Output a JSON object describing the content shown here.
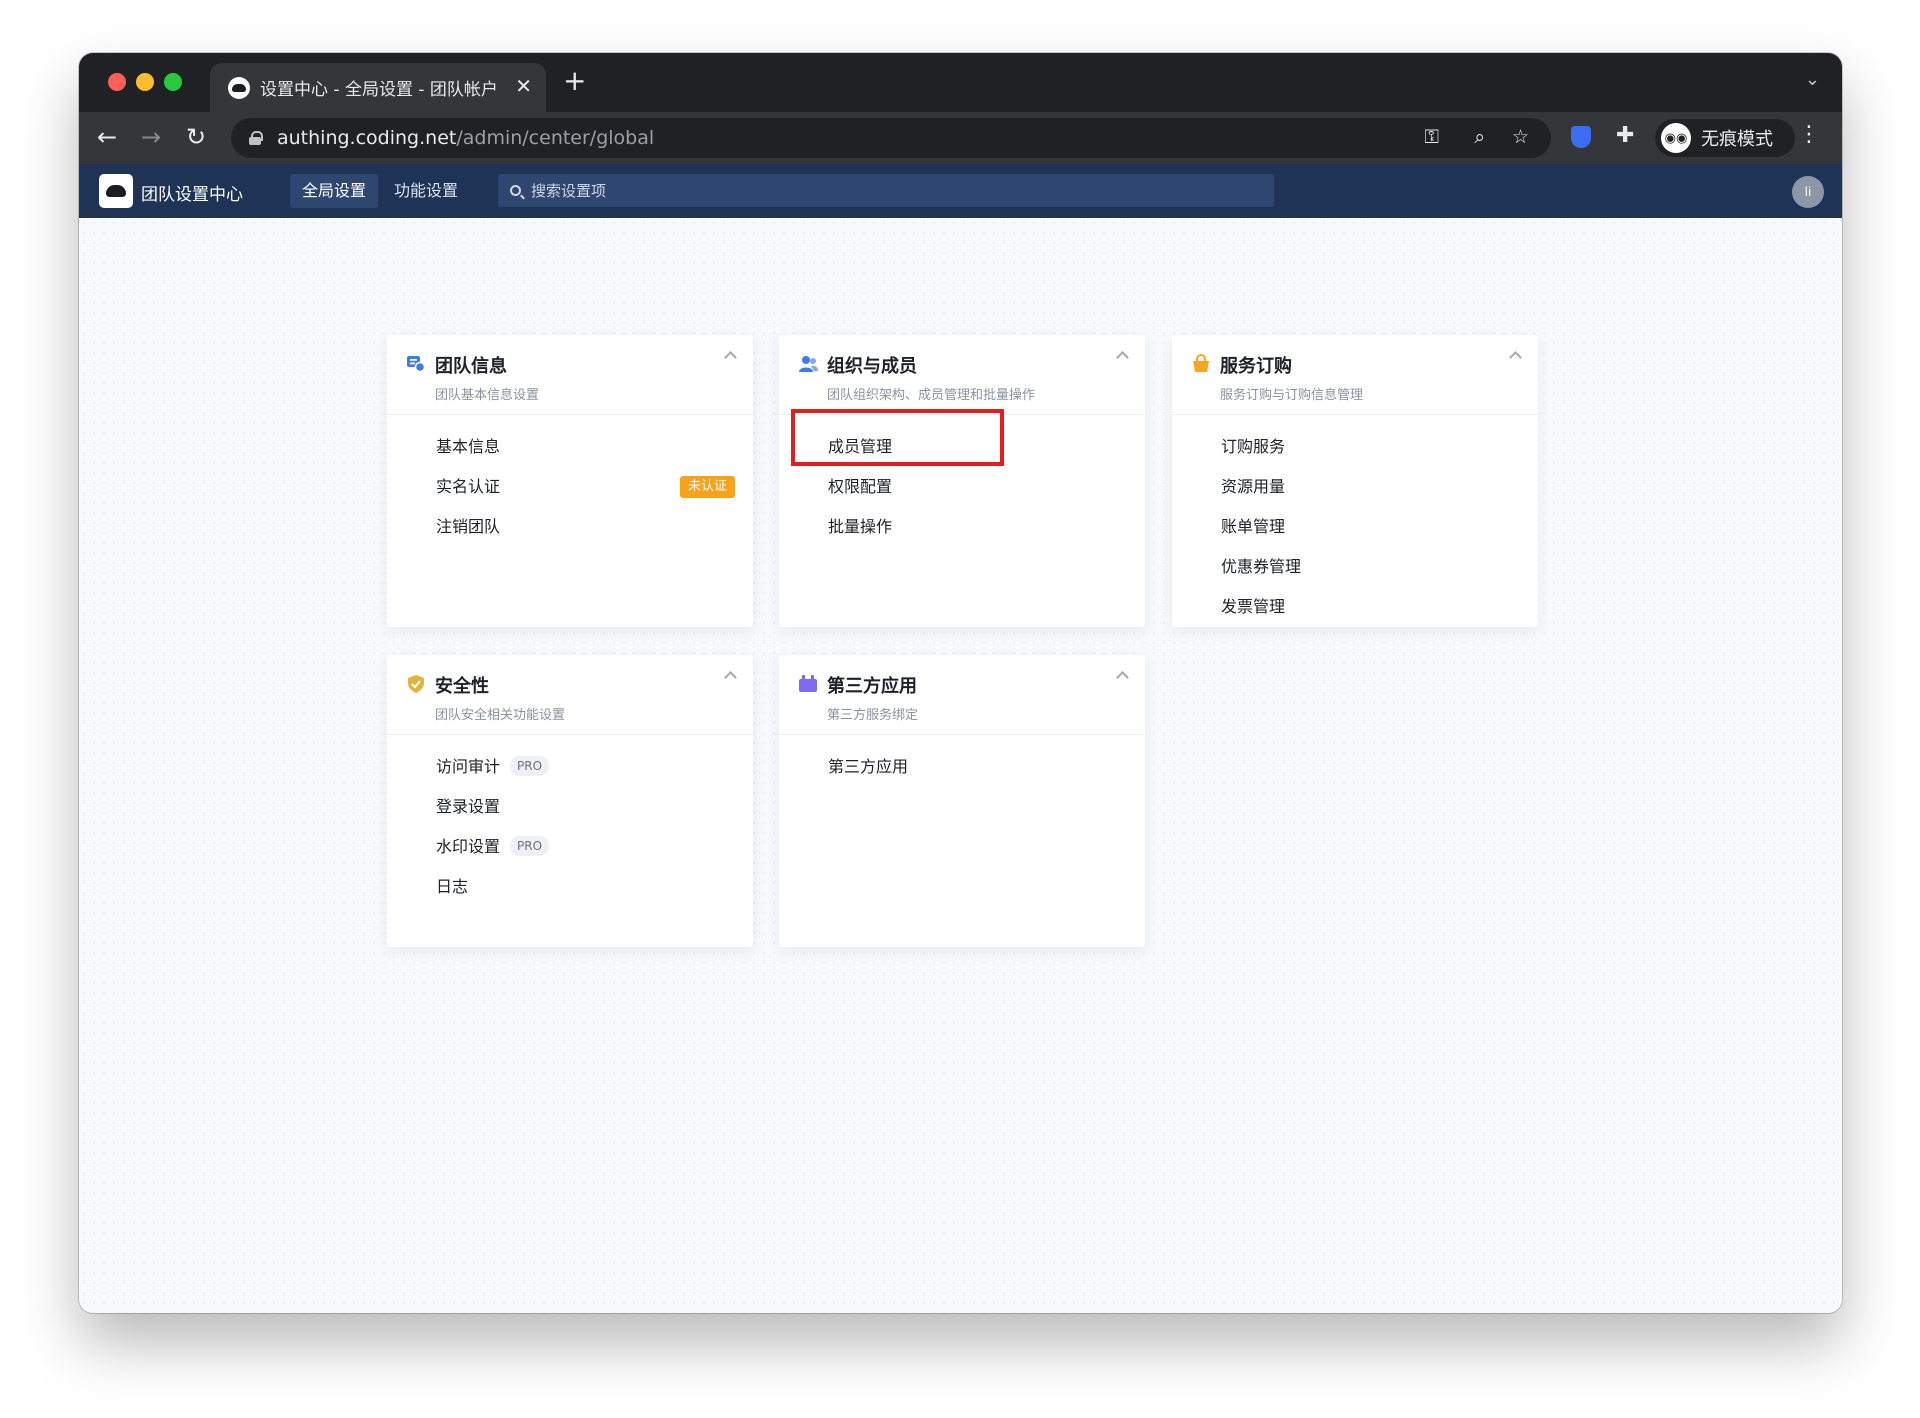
{
  "browser": {
    "tab_title": "设置中心 - 全局设置 - 团队帐户",
    "url_host": "authing.coding.net",
    "url_path": "/admin/center/global",
    "incognito_label": "无痕模式"
  },
  "app": {
    "brand": "团队设置中心",
    "nav": [
      "全局设置",
      "功能设置"
    ],
    "active_nav": "全局设置",
    "search_placeholder": "搜索设置项",
    "user_initial": "li"
  },
  "cards": [
    {
      "title": "团队信息",
      "subtitle": "团队基本信息设置",
      "icon": "team-info-icon",
      "items": [
        {
          "label": "基本信息"
        },
        {
          "label": "实名认证",
          "badge": "未认证"
        },
        {
          "label": "注销团队"
        }
      ]
    },
    {
      "title": "组织与成员",
      "subtitle": "团队组织架构、成员管理和批量操作",
      "icon": "members-icon",
      "items": [
        {
          "label": "成员管理",
          "highlighted": true
        },
        {
          "label": "权限配置"
        },
        {
          "label": "批量操作"
        }
      ]
    },
    {
      "title": "服务订购",
      "subtitle": "服务订购与订购信息管理",
      "icon": "shopping-bag-icon",
      "items": [
        {
          "label": "订购服务"
        },
        {
          "label": "资源用量"
        },
        {
          "label": "账单管理"
        },
        {
          "label": "优惠券管理"
        },
        {
          "label": "发票管理"
        }
      ]
    },
    {
      "title": "安全性",
      "subtitle": "团队安全相关功能设置",
      "icon": "shield-check-icon",
      "items": [
        {
          "label": "访问审计",
          "pro": "PRO"
        },
        {
          "label": "登录设置"
        },
        {
          "label": "水印设置",
          "pro": "PRO"
        },
        {
          "label": "日志"
        }
      ]
    },
    {
      "title": "第三方应用",
      "subtitle": "第三方服务绑定",
      "icon": "apps-icon",
      "items": [
        {
          "label": "第三方应用"
        }
      ]
    }
  ],
  "colors": {
    "appbar": "#1f3356",
    "highlight": "#e0201f",
    "badge": "#f7a21b",
    "icon_blue": "#3b7cf6",
    "icon_orange": "#f5a623",
    "icon_gold": "#e2b33d",
    "icon_purple": "#7e6bf2"
  }
}
